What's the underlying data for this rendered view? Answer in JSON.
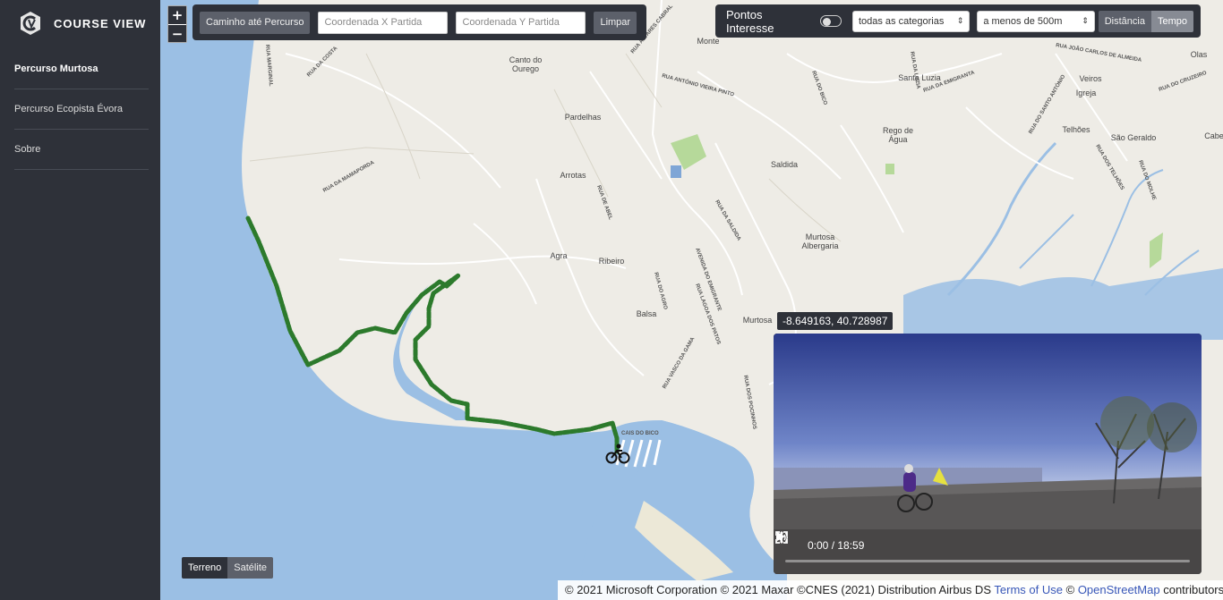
{
  "sidebar": {
    "brand_title": "COURSE VIEW",
    "items": [
      {
        "label": "Percurso Murtosa",
        "active": true
      },
      {
        "label": "Percurso Ecopista Évora",
        "active": false
      },
      {
        "label": "Sobre",
        "active": false
      }
    ]
  },
  "map": {
    "zoom_in": "+",
    "zoom_out": "−",
    "route": {
      "path_button": "Caminho até Percurso",
      "x_placeholder": "Coordenada X Partida",
      "y_placeholder": "Coordenada Y Partida",
      "clear_button": "Limpar"
    },
    "poi": {
      "label": "Pontos Interesse",
      "toggle_on": false,
      "category_value": "todas as categorias",
      "distance_value": "a menos de 500m",
      "distance_mode_button": "Distância",
      "time_mode_button": "Tempo"
    },
    "layers": {
      "terrain": "Terreno",
      "satellite": "Satélite"
    },
    "coord_tooltip": "-8.649163, 40.728987",
    "places": [
      "Monte",
      "Canto do",
      "Ourego",
      "Pardelhas",
      "Arrotas",
      "Agra",
      "Ribeiro",
      "Balsa",
      "Murtosa",
      "Albergaria",
      "Saldida",
      "Rego de",
      "Água",
      "Santa Luzia",
      "Veiros",
      "Igreja",
      "Telhões",
      "São Geraldo",
      "Murtosa",
      "Olas",
      "Cabe"
    ],
    "streets": [
      "RUA MARGINAL",
      "RUA DA COSTA",
      "RUA DA MAMAPORDA",
      "RUA ÁLVARES CABRAL",
      "RUA ANTÓNIO VIEIRA PINTO",
      "RUA DA SALDIDA",
      "AVENIDA DO EMIGRANTE",
      "RUA LAGOA DOS PATOS",
      "RUA VASCO DA GAMA",
      "CAIS DO BICO",
      "RUA DO AGRO",
      "RUA DA EMIGRANTA",
      "RUA DO BICO",
      "RUA DOS TELHÕES",
      "RUA DO MOLHE",
      "RUA DO CRUZEIRO",
      "RUA DO SANTO ANTÓNIO",
      "RUA DE ABEL",
      "RUA DOS POCINHOS",
      "RUA JOÃO CARLOS DE ALMEIDA",
      "RUA DA LUZIA"
    ],
    "route_color": "#2c7a2c",
    "attribution": {
      "prefix": "© 2021 Microsoft Corporation © 2021 Maxar ©CNES (2021) Distribution Airbus DS",
      "terms_link": "Terms of Use",
      "middle": "©",
      "osm_link": "OpenStreetMap",
      "suffix": "contributors."
    }
  },
  "video": {
    "time": "0:00 / 18:59",
    "progress": 0
  }
}
